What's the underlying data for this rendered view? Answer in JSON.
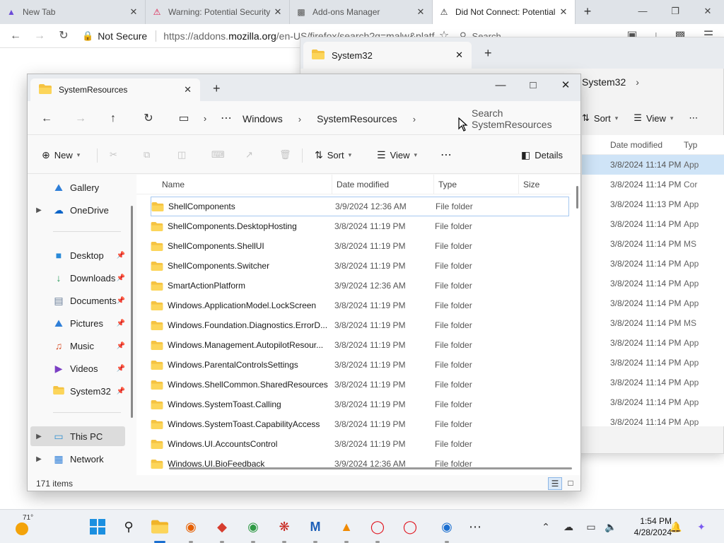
{
  "browser": {
    "tabs": [
      {
        "title": "New Tab",
        "icon": "firefox-newtab-icon"
      },
      {
        "title": "Warning: Potential Security Risk Ahead",
        "icon": "warning-icon"
      },
      {
        "title": "Add-ons Manager",
        "icon": "puzzle-icon"
      },
      {
        "title": "Did Not Connect: Potential Security Issue",
        "icon": "warning-icon"
      }
    ],
    "not_secure_label": "Not Secure",
    "url_prefix": "https://addons.",
    "url_domain": "mozilla.org",
    "url_suffix": "/en-US/firefox/search?q=malw&platf",
    "search_placeholder": "Search"
  },
  "system32_window": {
    "tab_title": "System32",
    "breadcrumb": "System32",
    "sort_label": "Sort",
    "view_label": "View",
    "columns": {
      "date": "Date modified",
      "type": "Typ"
    },
    "rows": [
      {
        "date": "3/8/2024 11:14 PM",
        "type": "App"
      },
      {
        "date": "3/8/2024 11:14 PM",
        "type": "Cor"
      },
      {
        "date": "3/8/2024 11:13 PM",
        "type": "App"
      },
      {
        "date": "3/8/2024 11:14 PM",
        "type": "App"
      },
      {
        "date": "3/8/2024 11:14 PM",
        "type": "MS"
      },
      {
        "date": "3/8/2024 11:14 PM",
        "type": "App"
      },
      {
        "date": "3/8/2024 11:14 PM",
        "type": "App"
      },
      {
        "date": "3/8/2024 11:14 PM",
        "type": "App"
      },
      {
        "date": "3/8/2024 11:14 PM",
        "type": "MS"
      },
      {
        "date": "3/8/2024 11:14 PM",
        "type": "App"
      },
      {
        "date": "3/8/2024 11:14 PM",
        "type": "App"
      },
      {
        "date": "3/8/2024 11:14 PM",
        "type": "App"
      },
      {
        "date": "3/8/2024 11:14 PM",
        "type": "App"
      },
      {
        "date": "3/8/2024 11:14 PM",
        "type": "App"
      }
    ]
  },
  "explorer": {
    "tab_title": "SystemResources",
    "breadcrumbs": [
      "Windows",
      "SystemResources"
    ],
    "search_placeholder": "Search SystemResources",
    "commands": {
      "new": "New",
      "sort": "Sort",
      "view": "View",
      "details": "Details"
    },
    "nav": [
      {
        "label": "Gallery",
        "icon": "gallery-icon"
      },
      {
        "label": "OneDrive",
        "icon": "onedrive-icon"
      },
      {
        "label": "Desktop",
        "icon": "desktop-icon"
      },
      {
        "label": "Downloads",
        "icon": "downloads-icon"
      },
      {
        "label": "Documents",
        "icon": "documents-icon"
      },
      {
        "label": "Pictures",
        "icon": "pictures-icon"
      },
      {
        "label": "Music",
        "icon": "music-icon"
      },
      {
        "label": "Videos",
        "icon": "videos-icon"
      },
      {
        "label": "System32",
        "icon": "folder-icon"
      },
      {
        "label": "This PC",
        "icon": "this-pc-icon"
      },
      {
        "label": "Network",
        "icon": "network-icon"
      }
    ],
    "columns": {
      "name": "Name",
      "date": "Date modified",
      "type": "Type",
      "size": "Size"
    },
    "files": [
      {
        "name": "ShellComponents",
        "date": "3/9/2024 12:36 AM",
        "type": "File folder"
      },
      {
        "name": "ShellComponents.DesktopHosting",
        "date": "3/8/2024 11:19 PM",
        "type": "File folder"
      },
      {
        "name": "ShellComponents.ShellUI",
        "date": "3/8/2024 11:19 PM",
        "type": "File folder"
      },
      {
        "name": "ShellComponents.Switcher",
        "date": "3/8/2024 11:19 PM",
        "type": "File folder"
      },
      {
        "name": "SmartActionPlatform",
        "date": "3/9/2024 12:36 AM",
        "type": "File folder"
      },
      {
        "name": "Windows.ApplicationModel.LockScreen",
        "date": "3/8/2024 11:19 PM",
        "type": "File folder"
      },
      {
        "name": "Windows.Foundation.Diagnostics.ErrorD...",
        "date": "3/8/2024 11:19 PM",
        "type": "File folder"
      },
      {
        "name": "Windows.Management.AutopilotResour...",
        "date": "3/8/2024 11:19 PM",
        "type": "File folder"
      },
      {
        "name": "Windows.ParentalControlsSettings",
        "date": "3/8/2024 11:19 PM",
        "type": "File folder"
      },
      {
        "name": "Windows.ShellCommon.SharedResources",
        "date": "3/8/2024 11:19 PM",
        "type": "File folder"
      },
      {
        "name": "Windows.SystemToast.Calling",
        "date": "3/8/2024 11:19 PM",
        "type": "File folder"
      },
      {
        "name": "Windows.SystemToast.CapabilityAccess",
        "date": "3/8/2024 11:19 PM",
        "type": "File folder"
      },
      {
        "name": "Windows.UI.AccountsControl",
        "date": "3/8/2024 11:19 PM",
        "type": "File folder"
      },
      {
        "name": "Windows.UI.BioFeedback",
        "date": "3/9/2024 12:36 AM",
        "type": "File folder"
      }
    ],
    "status": "171 items"
  },
  "taskbar": {
    "temperature": "71°",
    "time": "1:54 PM",
    "date": "4/28/2024",
    "accent": "#1b6fd0"
  }
}
